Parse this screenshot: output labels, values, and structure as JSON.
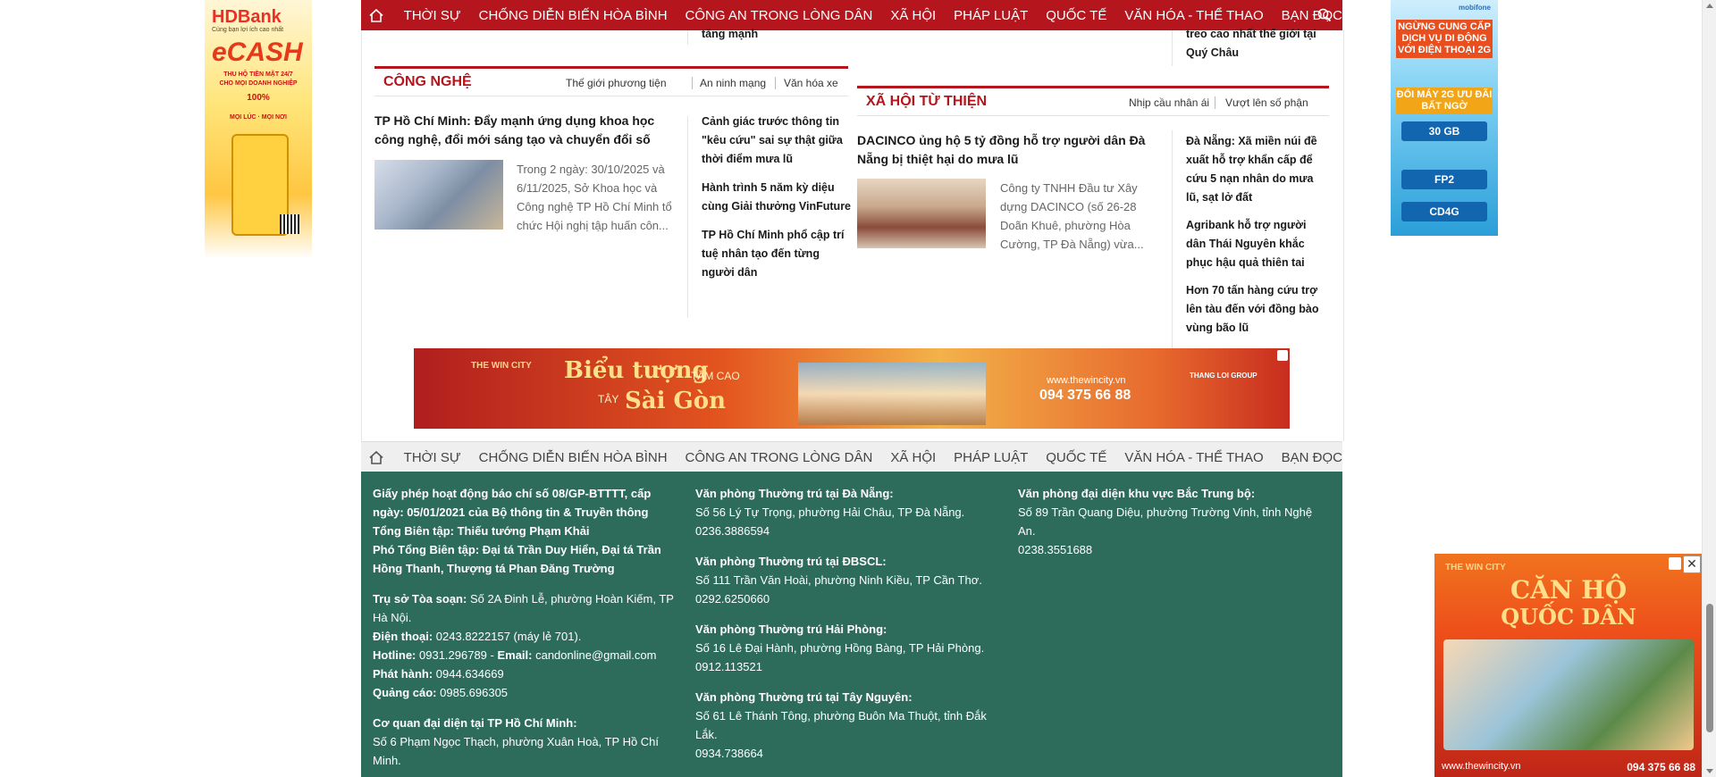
{
  "nav": {
    "home_icon": "home-icon",
    "items": [
      "THỜI SỰ",
      "CHỐNG DIỄN BIẾN HÒA BÌNH",
      "CÔNG AN TRONG LÒNG DÂN",
      "XÃ HỘI",
      "PHÁP LUẬT",
      "QUỐC TẾ",
      "VĂN HÓA - THỂ THAO",
      "BẠN ĐỌC"
    ],
    "search_icon": "search-icon"
  },
  "top_fragments": {
    "left": "tăng mạnh",
    "right": "treo cao nhất thế giới tại Quý Châu"
  },
  "tech": {
    "title": "CÔNG NGHỆ",
    "subs": [
      "Thế giới phương tiện",
      "An ninh mạng",
      "Văn hóa xe"
    ],
    "headline": "TP Hồ Chí Minh: Đẩy mạnh ứng dụng khoa học công nghệ, đổi mới sáng tạo và chuyển đổi số",
    "summary": "Trong 2 ngày: 30/10/2025 và 6/11/2025, Sở Khoa học và Công nghệ TP Hồ Chí Minh tổ chức Hội nghị tập huấn côn...",
    "side": [
      "Cảnh giác trước thông tin \"kêu cứu\" sai sự thật giữa thời điểm mưa lũ",
      "Hành trình 5 năm kỳ diệu cùng Giải thưởng VinFuture",
      "TP Hồ Chí Minh phổ cập trí tuệ nhân tạo đến từng người dân"
    ]
  },
  "charity": {
    "title": "XÃ HỘI TỪ THIỆN",
    "subs": [
      "Nhịp cầu nhân ái",
      "Vượt lên số phận"
    ],
    "headline": "DACINCO ủng hộ 5 tỷ đồng hỗ trợ người dân Đà Nẵng bị thiệt hại do mưa lũ",
    "summary": "Công ty TNHH Đầu tư Xây dựng DACINCO (số 26-28 Doãn Khuê, phường Hòa Cường, TP Đà Nẵng) vừa...",
    "side": [
      "Đà Nẵng: Xã miền núi đề xuất hỗ trợ khẩn cấp để cứu 5 nạn nhân do mưa lũ, sạt lở đất",
      "Agribank hỗ trợ người dân Thái Nguyên khắc phục hậu quả thiên tai",
      "Hơn 70 tấn hàng cứu trợ lên tàu đến với đồng bào vùng bão lũ"
    ]
  },
  "ads": {
    "left": {
      "brand": "HDBank",
      "brand_sub": "Cùng bạn lợi ích cao nhất",
      "product": "eCASH",
      "line1": "THU HỘ TIỀN MẶT 24/7",
      "line2": "CHO MỌI DOANH NGHIỆP",
      "line3": "100%",
      "line4": "MỌI LÚC · MỌI NƠI"
    },
    "right": {
      "brand": "mobifone",
      "headline": "NGỪNG CUNG CẤP DỊCH VỤ DI ĐỘNG VỚI ĐIỆN THOẠI 2G",
      "sub": "ĐỔI MÁY 2G ƯU ĐÃI BẤT NGỜ",
      "plans": [
        "30 GB",
        "FP2",
        "CD4G"
      ]
    },
    "banner": {
      "logo": "THE WIN CITY",
      "slogan1": "Biểu tượng",
      "slogan1_small": "TẦM CAO",
      "slogan2_small": "TÂY",
      "slogan2": "Sài Gòn",
      "website": "www.thewincity.vn",
      "hotline": "094 375 66 88",
      "group": "THANG LOI GROUP"
    },
    "float": {
      "logo": "THE WIN CITY",
      "line1": "CĂN HỘ",
      "line2": "QUỐC DÂN",
      "website": "www.thewincity.vn",
      "hotline": "094 375 66 88",
      "close": "✕"
    }
  },
  "footer": {
    "col1": [
      {
        "b": "Giấy phép hoạt động báo chí số 08/GP-BTTTT, cấp ngày: 05/01/2021 của Bộ thông tin & Truyền thông",
        "t": ""
      },
      {
        "b": "Tổng Biên tập: Thiếu tướng Phạm Khải",
        "t": ""
      },
      {
        "b": "Phó Tổng Biên tập: Đại tá Trần Duy Hiển, Đại tá Trần Hồng Thanh, Thượng tá Phan Đăng Trường",
        "t": ""
      },
      {
        "b": "Trụ sở Tòa soạn:",
        "t": " Số 2A Đinh Lễ, phường Hoàn Kiếm, TP Hà Nội."
      },
      {
        "b": "Điện thoại:",
        "t": " 0243.8222157 (máy lẻ 701)."
      },
      {
        "b": "Hotline:",
        "t": " 0931.296789 - ",
        "b2": "Email:",
        "t2": " candonline@gmail.com"
      },
      {
        "b": "Phát hành:",
        "t": " 0944.634669"
      },
      {
        "b": "Quảng cáo:",
        "t": " 0985.696305"
      },
      {
        "b": "Cơ quan đại diện tại TP Hồ Chí Minh:",
        "t": ""
      },
      {
        "b": "",
        "t": "Số 6 Phạm Ngọc Thạch, phường Xuân Hoà, TP Hồ Chí Minh."
      }
    ],
    "col2": [
      {
        "h": "Văn phòng Thường trú tại Đà Nẵng:",
        "a": "Số 56 Lý Tự Trọng, phường Hải Châu, TP Đà Nẵng.",
        "p": "0236.3886594"
      },
      {
        "h": "Văn phòng Thường trú tại ĐBSCL:",
        "a": "Số 111 Trần Văn Hoài, phường Ninh Kiều, TP Cần Thơ.",
        "p": "0292.6250660"
      },
      {
        "h": "Văn phòng Thường trú Hải Phòng:",
        "a": "Số 16 Lê Đại Hành, phường Hồng Bàng, TP Hải Phòng.",
        "p": "0912.113521"
      },
      {
        "h": "Văn phòng Thường trú tại Tây Nguyên:",
        "a": "Số 61 Lê Thánh Tông, phường Buôn Ma Thuột, tỉnh Đắk Lắk.",
        "p": "0934.738664"
      }
    ],
    "col3": [
      {
        "h": "Văn phòng đại diện khu vực Bắc Trung bộ:",
        "a": "Số 89 Trần Quang Diệu, phường Trường Vinh, tỉnh Nghệ An.",
        "p": "0238.3551688"
      }
    ]
  }
}
